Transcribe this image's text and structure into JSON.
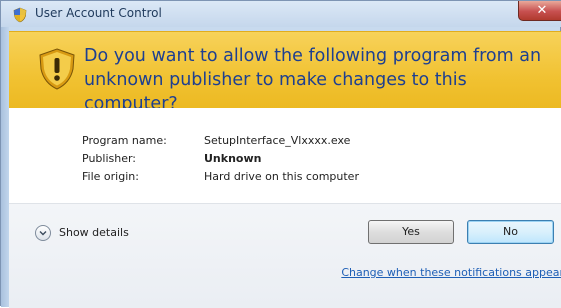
{
  "window": {
    "title": "User Account Control",
    "close_label": "✕"
  },
  "banner": {
    "heading": "Do you want to allow the following program from an unknown publisher to make changes to this computer?"
  },
  "program_info": {
    "rows": [
      {
        "label": "Program name:",
        "value": "SetupInterface_Vlxxxx.exe",
        "bold": false
      },
      {
        "label": "Publisher:",
        "value": "Unknown",
        "bold": true
      },
      {
        "label": "File origin:",
        "value": "Hard drive on this computer",
        "bold": false
      }
    ]
  },
  "footer": {
    "details_label": "Show details",
    "yes_label": "Yes",
    "no_label": "No",
    "link_text": "Change when these notifications appear"
  },
  "icons": {
    "title_icon": "uac-shield-icon",
    "banner_icon": "warning-shield-icon",
    "details_icon": "chevron-down-icon"
  },
  "colors": {
    "banner_bg": "#f1c232",
    "banner_text": "#1d3f91",
    "link": "#1e5fb6",
    "close_button": "#c75050"
  }
}
